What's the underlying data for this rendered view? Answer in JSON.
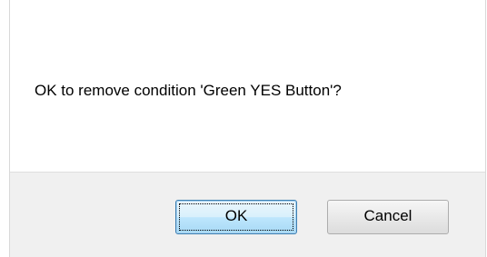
{
  "dialog": {
    "message": "OK to remove condition 'Green YES Button'?",
    "buttons": {
      "ok_label": "OK",
      "cancel_label": "Cancel"
    }
  }
}
